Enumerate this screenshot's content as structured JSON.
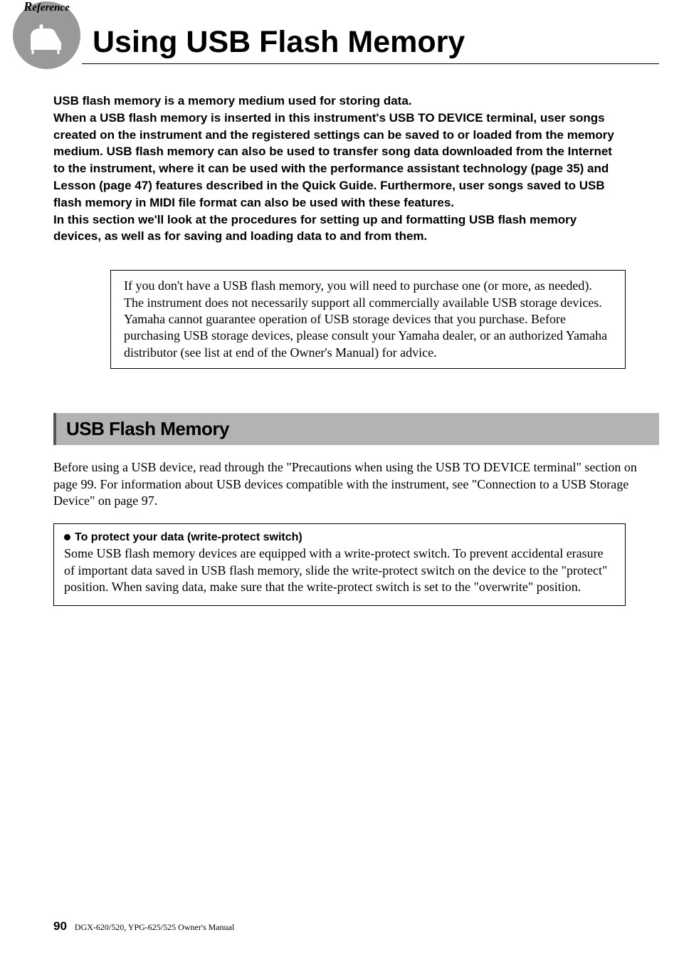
{
  "badge": {
    "label": "eference"
  },
  "page_title": "Using USB Flash Memory",
  "intro": "USB flash memory is a memory medium used for storing data.\nWhen a USB flash memory is inserted in this instrument's USB TO DEVICE terminal, user songs created on the instrument and the registered settings can be saved to or loaded from the memory medium. USB flash memory can also be used to transfer song data downloaded from the Internet to the instrument, where it can be used with the performance assistant technology (page 35) and Lesson (page 47) features described in the Quick Guide. Furthermore, user songs saved to USB flash memory in MIDI file format can also be used with these features.\nIn this section we'll look at the procedures for setting up and formatting USB flash memory devices, as well as for saving and loading data to and from them.",
  "note": "If you don't have a USB flash memory, you will need to purchase one (or more, as needed).\nThe instrument does not necessarily support all commercially available USB storage devices. Yamaha cannot guarantee operation of USB storage devices that you purchase. Before purchasing USB storage devices, please consult your Yamaha dealer, or an authorized Yamaha distributor (see list at end of the Owner's Manual) for advice.",
  "section_heading": "USB Flash Memory",
  "body": "Before using a USB device, read through the \"Precautions when using the USB TO DEVICE terminal\" section on page 99. For information about USB devices compatible with the instrument, see \"Connection to a USB Storage Device\" on page 97.",
  "protect": {
    "heading": "To protect your data (write-protect switch)",
    "body": "Some USB flash memory devices are equipped with a write-protect switch. To prevent accidental erasure of important data saved in USB flash memory, slide the write-protect switch on the device to the \"protect\" position. When saving data, make sure that the write-protect switch is set to the \"overwrite\" position."
  },
  "footer": {
    "page_number": "90",
    "manual": "DGX-620/520, YPG-625/525  Owner's Manual"
  }
}
